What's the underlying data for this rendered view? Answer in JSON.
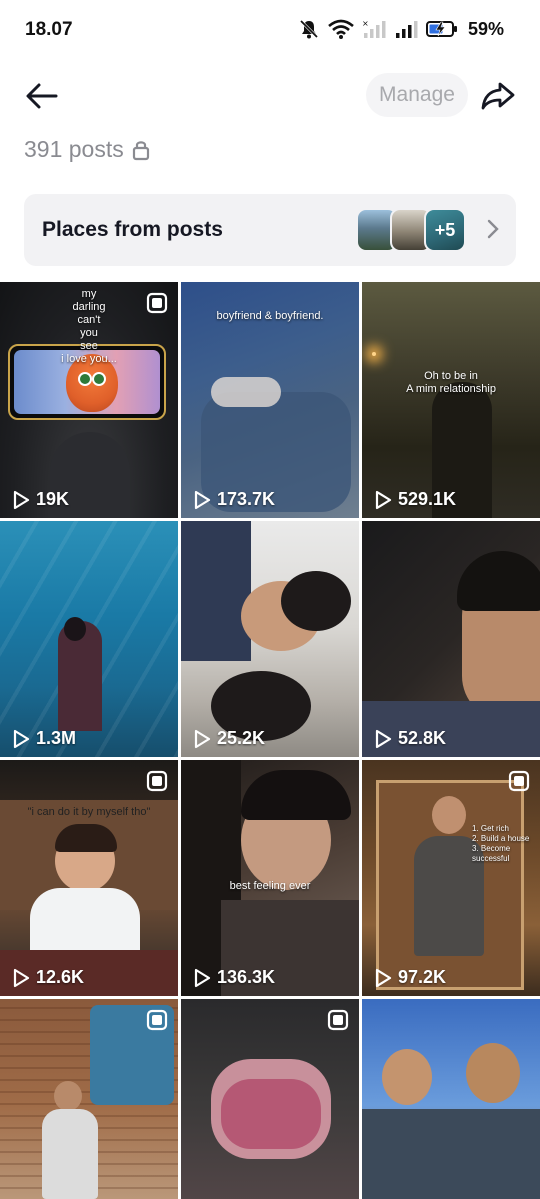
{
  "status_bar": {
    "time": "18.07",
    "battery_percent": "59%"
  },
  "header": {
    "manage_label": "Manage"
  },
  "posts": {
    "count_label": "391 posts"
  },
  "places": {
    "label": "Places from posts",
    "more_badge": "+5"
  },
  "grid": [
    {
      "views": "19K",
      "multi_photo": true,
      "caption": "my\ndarling\ncan't\nyou\nsee\ni love you..."
    },
    {
      "views": "173.7K",
      "multi_photo": false,
      "caption": "boyfriend & boyfriend."
    },
    {
      "views": "529.1K",
      "multi_photo": false,
      "caption": "Oh to be in\nA mim relationship"
    },
    {
      "views": "1.3M",
      "multi_photo": false,
      "caption": ""
    },
    {
      "views": "25.2K",
      "multi_photo": false,
      "caption": ""
    },
    {
      "views": "52.8K",
      "multi_photo": false,
      "caption": ""
    },
    {
      "views": "12.6K",
      "multi_photo": true,
      "caption": "\"i can do it by myself tho\""
    },
    {
      "views": "136.3K",
      "multi_photo": false,
      "caption": "best feeling ever"
    },
    {
      "views": "97.2K",
      "multi_photo": true,
      "caption": "1. Get rich\n2. Build a house\n3. Become successful"
    },
    {
      "views": "",
      "multi_photo": true,
      "caption": ""
    },
    {
      "views": "",
      "multi_photo": true,
      "caption": ""
    },
    {
      "views": "",
      "multi_photo": false,
      "caption": ""
    }
  ]
}
